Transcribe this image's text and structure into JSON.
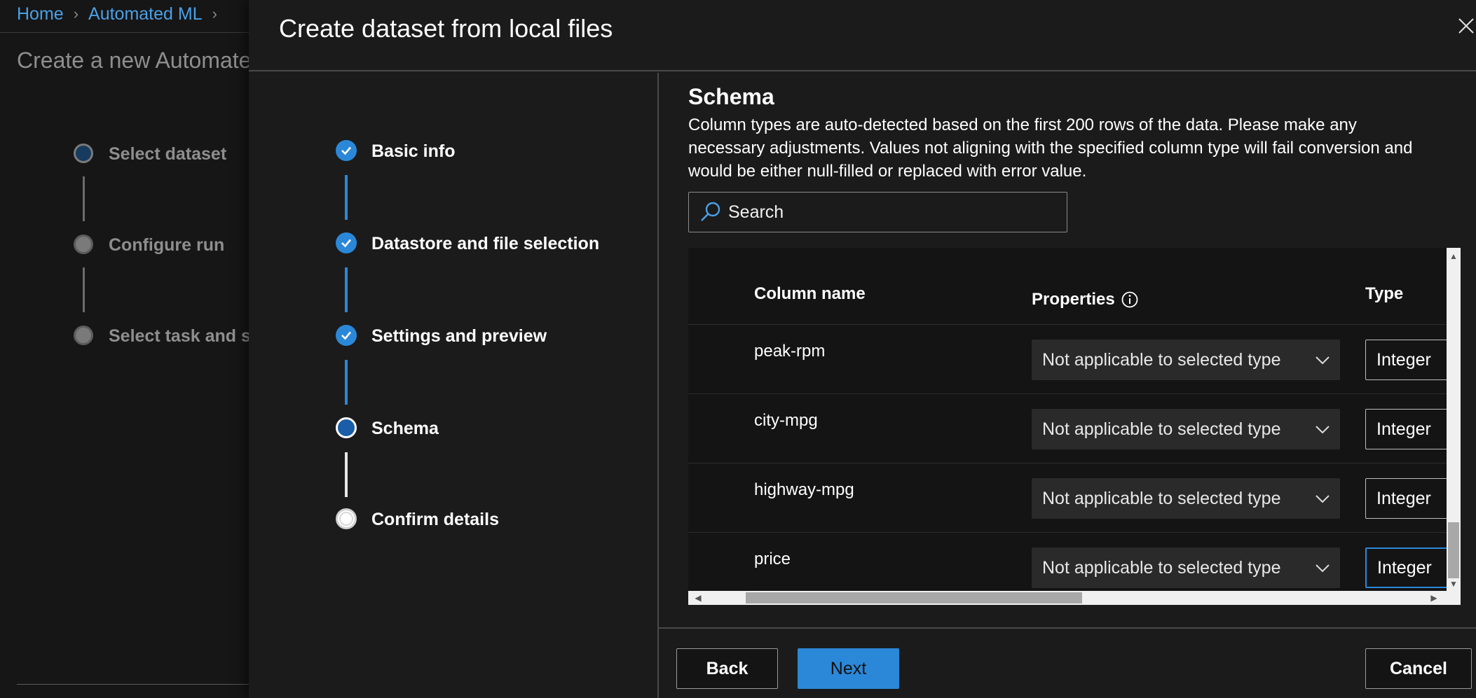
{
  "breadcrumb": {
    "home": "Home",
    "automated_ml": "Automated ML"
  },
  "background": {
    "title": "Create a new Automate",
    "steps": [
      {
        "label": "Select dataset"
      },
      {
        "label": "Configure run"
      },
      {
        "label": "Select task and se"
      }
    ]
  },
  "panel": {
    "title": "Create dataset from local files",
    "steps": [
      {
        "label": "Basic info",
        "state": "done"
      },
      {
        "label": "Datastore and file selection",
        "state": "done"
      },
      {
        "label": "Settings and preview",
        "state": "done"
      },
      {
        "label": "Schema",
        "state": "current"
      },
      {
        "label": "Confirm details",
        "state": "todo"
      }
    ],
    "schema": {
      "title": "Schema",
      "description": "Column types are auto-detected based on the first 200 rows of the data. Please make any necessary adjustments. Values not aligning with the specified column type will fail conversion and would be either null-filled or replaced with error value.",
      "search_placeholder": "Search",
      "columns": {
        "name": "Column name",
        "properties": "Properties",
        "type": "Type"
      },
      "rows": [
        {
          "name": "peak-rpm",
          "properties": "Not applicable to selected type",
          "type": "Integer"
        },
        {
          "name": "city-mpg",
          "properties": "Not applicable to selected type",
          "type": "Integer"
        },
        {
          "name": "highway-mpg",
          "properties": "Not applicable to selected type",
          "type": "Integer"
        },
        {
          "name": "price",
          "properties": "Not applicable to selected type",
          "type": "Integer"
        }
      ]
    },
    "buttons": {
      "back": "Back",
      "next": "Next",
      "cancel": "Cancel"
    }
  },
  "colors": {
    "accent": "#2b88d8",
    "panel_bg": "#1b1b1b",
    "link": "#4aa0e6"
  }
}
